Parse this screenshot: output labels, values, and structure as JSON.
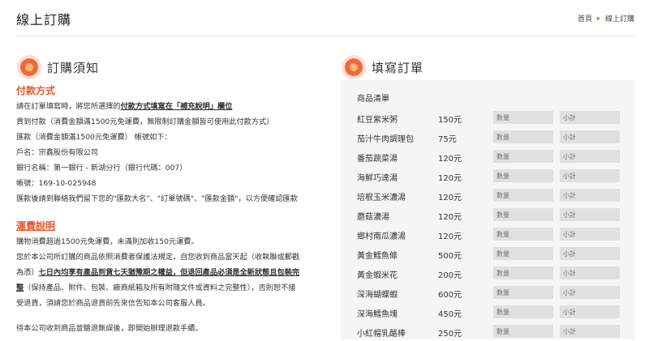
{
  "header": {
    "title": "線上訂購",
    "breadcrumb": {
      "home": "首頁",
      "sep": "▸",
      "current": "線上訂購"
    }
  },
  "notice": {
    "title": "訂購須知",
    "payment": {
      "heading": "付款方式",
      "line1_pre": "請在訂單填寫時，將您所選擇的",
      "line1_bold": "付款方式填寫在「補充說明」欄位",
      "line2": "貨到付款（消費金額滿1500元免運費，無限制訂購金額皆可使用此付款方式）",
      "line3": "匯款（消費金額滿1500元免運費） 帳號如下：",
      "line4": "戶名：宗鑫股份有限公司",
      "line5": "銀行名稱：第一銀行 - 新湖分行（銀行代碼：007）",
      "line6": "帳號：169-10-025948",
      "line7": "匯款後請到聯絡我們留下您的\"匯款大名\"、\"訂單號碼\"、\"匯款金額\"，以方便確認匯款"
    },
    "shipping": {
      "heading": "運費說明",
      "line1": "購物消費超過1500元免運費，未滿則加收150元運費。",
      "line2": "您於本公司所訂購的商品依照消費者保護法規定，自您收到商品當天起（收執聯或郵戳",
      "line3_pre": "為憑）",
      "line3_bold": "七日內均享有產品到貨七天猶豫期之權益，但退回產品必須是全新狀態且包裝完",
      "line4_bold": "整",
      "line4_rest": "（保持產品、附件、包裝、廠商紙箱及所有附隨文件或資料之完整性），否則恕不接",
      "line5": "受退貨，須請您於商品退貨前先來信告知本公司客服人員。",
      "line6": "待本公司收到商品並驗退無誤後，即開始辦理退款手續。"
    }
  },
  "order": {
    "title": "填寫訂單",
    "list_label": "商品清單",
    "qty_placeholder": "數量",
    "subtotal_placeholder": "小計",
    "items": [
      {
        "name": "紅豆紫米粥",
        "price": "150元"
      },
      {
        "name": "茄汁牛肉調理包",
        "price": "75元"
      },
      {
        "name": "番茄蔬菜湯",
        "price": "120元"
      },
      {
        "name": "海鮮巧達湯",
        "price": "120元"
      },
      {
        "name": "培根玉米濃湯",
        "price": "120元"
      },
      {
        "name": "蘑菇濃湯",
        "price": "120元"
      },
      {
        "name": "鄉村南瓜濃湯",
        "price": "120元"
      },
      {
        "name": "黃金鱈魚條",
        "price": "500元"
      },
      {
        "name": "黃金蝦米花",
        "price": "200元"
      },
      {
        "name": "深海蝴蝶蝦",
        "price": "600元"
      },
      {
        "name": "深海鱈魚塊",
        "price": "450元"
      },
      {
        "name": "小紅帽乳酪棒",
        "price": "250元"
      }
    ]
  }
}
